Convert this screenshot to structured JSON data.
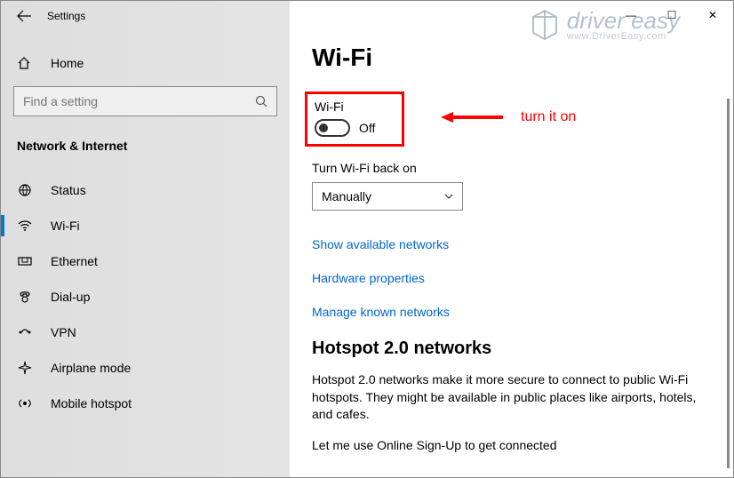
{
  "window": {
    "title": "Settings",
    "controls": {
      "min": "—",
      "max": "☐",
      "close": "✕"
    }
  },
  "sidebar": {
    "home_label": "Home",
    "search_placeholder": "Find a setting",
    "section_label": "Network & Internet",
    "items": [
      {
        "label": "Status",
        "icon": "status-icon",
        "active": false
      },
      {
        "label": "Wi-Fi",
        "icon": "wifi-icon",
        "active": true
      },
      {
        "label": "Ethernet",
        "icon": "ethernet-icon",
        "active": false
      },
      {
        "label": "Dial-up",
        "icon": "dialup-icon",
        "active": false
      },
      {
        "label": "VPN",
        "icon": "vpn-icon",
        "active": false
      },
      {
        "label": "Airplane mode",
        "icon": "airplane-icon",
        "active": false
      },
      {
        "label": "Mobile hotspot",
        "icon": "hotspot-icon",
        "active": false
      }
    ]
  },
  "main": {
    "page_title": "Wi-Fi",
    "wifi_section_label": "Wi-Fi",
    "toggle_state_label": "Off",
    "turnback_label": "Turn Wi-Fi back on",
    "dropdown_value": "Manually",
    "links": {
      "available": "Show available networks",
      "hardware": "Hardware properties",
      "known": "Manage known networks"
    },
    "hotspot_title": "Hotspot 2.0 networks",
    "hotspot_text": "Hotspot 2.0 networks make it more secure to connect to public Wi-Fi hotspots. They might be available in public places like airports, hotels, and cafes.",
    "cutoff_text": "Let me use Online Sign-Up to get connected"
  },
  "annotation": {
    "text": "turn it on"
  },
  "watermark": {
    "brand": "driver easy",
    "url": "www.DriverEasy.com"
  }
}
